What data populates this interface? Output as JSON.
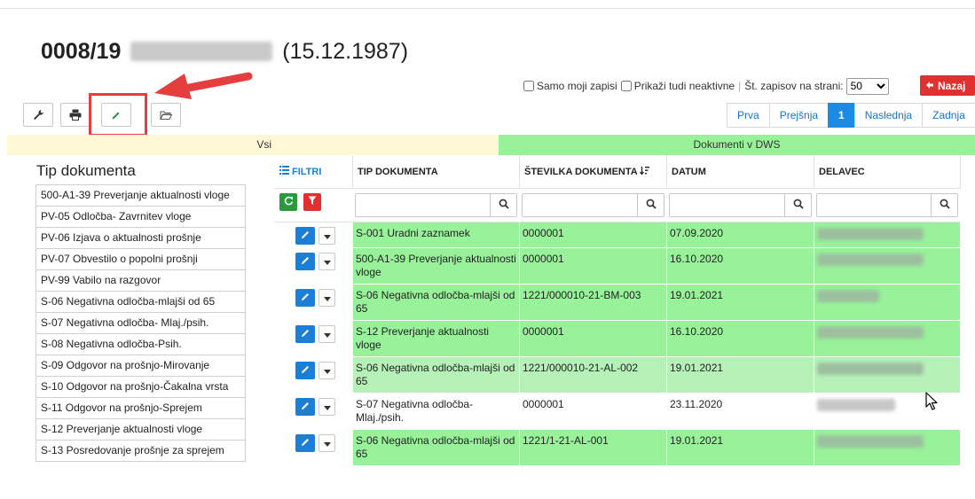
{
  "header": {
    "record_number": "0008/19",
    "record_date": "(15.12.1987)"
  },
  "options": {
    "only_mine_label": "Samo moji zapisi",
    "show_inactive_label": "Prikaži tudi neaktivne",
    "separator": "|",
    "per_page_label": "Št. zapisov na strani:",
    "per_page_value": "50",
    "back_label": "Nazaj"
  },
  "toolbar": {
    "icons": [
      "wrench-icon",
      "print-icon",
      "pencil-icon",
      "folder-open-icon"
    ]
  },
  "pager": {
    "first": "Prva",
    "prev": "Prejšnja",
    "current": "1",
    "next": "Naslednja",
    "last": "Zadnja"
  },
  "bands": {
    "left": "Vsi",
    "right": "Dokumenti v DWS"
  },
  "sidebar": {
    "title": "Tip dokumenta",
    "items": [
      "500-A1-39 Preverjanje aktualnosti vloge",
      "PV-05 Odločba- Zavrnitev vloge",
      "PV-06 Izjava o aktualnosti prošnje",
      "PV-07 Obvestilo o popolni prošnji",
      "PV-99 Vabilo na razgovor",
      "S-06 Negativna odločba-mlajši od 65",
      "S-07 Negativna odločba- Mlaj./psih.",
      "S-08 Negativna odločba-Psih.",
      "S-09 Odgovor na prošnjo-Mirovanje",
      "S-10 Odgovor na prošnjo-Čakalna vrsta",
      "S-11 Odgovor na prošnjo-Sprejem",
      "S-12 Preverjanje aktualnosti vloge",
      "S-13 Posredovanje prošnje za sprejem"
    ]
  },
  "table": {
    "filters_label": "FILTRI",
    "columns": [
      "TIP DOKUMENTA",
      "ŠTEVILKA DOKUMENTA",
      "DATUM",
      "DELAVEC"
    ],
    "rows": [
      {
        "tip": "S-001 Uradni zaznamek",
        "stevilka": "0000001",
        "datum": "07.09.2020",
        "state": "green"
      },
      {
        "tip": "500-A1-39 Preverjanje aktualnosti vloge",
        "stevilka": "0000001",
        "datum": "16.10.2020",
        "state": "green"
      },
      {
        "tip": "S-06 Negativna odločba-mlajši od 65",
        "stevilka": "1221/000010-21-BM-003",
        "datum": "19.01.2021",
        "state": "green"
      },
      {
        "tip": "S-12 Preverjanje aktualnosti vloge",
        "stevilka": "0000001",
        "datum": "16.10.2020",
        "state": "green"
      },
      {
        "tip": "S-06 Negativna odločba-mlajši od 65",
        "stevilka": "1221/000010-21-AL-002",
        "datum": "19.01.2021",
        "state": "hover"
      },
      {
        "tip": "S-07 Negativna odločba-Mlaj./psih.",
        "stevilka": "0000001",
        "datum": "23.11.2020",
        "state": "white"
      },
      {
        "tip": "S-06 Negativna odločba-mlajši od 65",
        "stevilka": "1221/1-21-AL-001",
        "datum": "19.01.2021",
        "state": "green"
      }
    ]
  },
  "colors": {
    "green_row": "#97f29a",
    "yellow_band": "#fff8d6",
    "accent_blue": "#1c7fd6",
    "red": "#e03030"
  }
}
